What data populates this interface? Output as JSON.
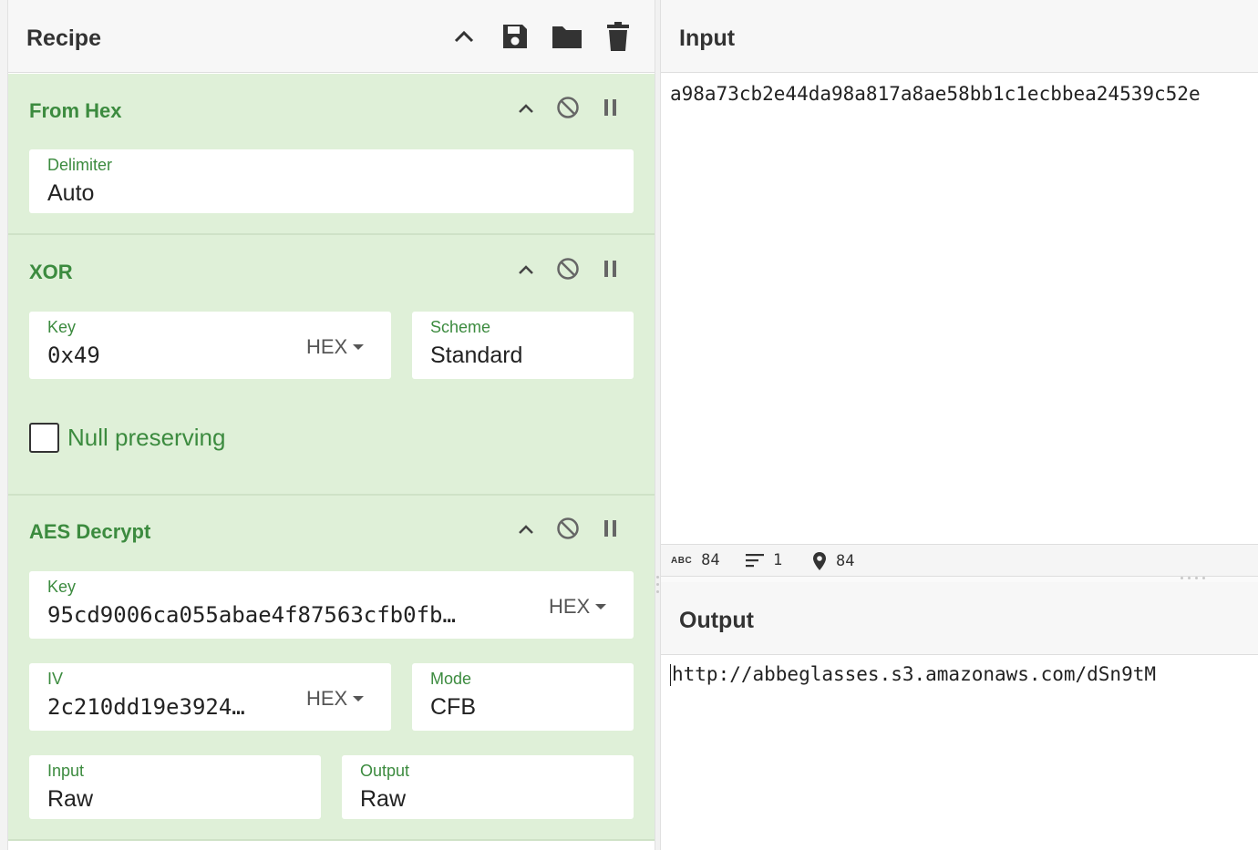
{
  "recipe": {
    "title": "Recipe",
    "operations": [
      {
        "name": "From Hex",
        "fields": [
          {
            "label": "Delimiter",
            "value": "Auto"
          }
        ]
      },
      {
        "name": "XOR",
        "fields": [
          {
            "label": "Key",
            "value": "0x49",
            "type": "HEX"
          },
          {
            "label": "Scheme",
            "value": "Standard"
          }
        ],
        "checkbox": {
          "label": "Null preserving",
          "checked": false
        }
      },
      {
        "name": "AES Decrypt",
        "fields": [
          {
            "label": "Key",
            "value": "95cd9006ca055abae4f87563cfb0fb…",
            "type": "HEX"
          },
          {
            "label": "IV",
            "value": "2c210dd19e3924…",
            "type": "HEX"
          },
          {
            "label": "Mode",
            "value": "CFB"
          },
          {
            "label": "Input",
            "value": "Raw"
          },
          {
            "label": "Output",
            "value": "Raw"
          }
        ]
      }
    ]
  },
  "input": {
    "title": "Input",
    "text": "a98a73cb2e44da98a817a8ae58bb1c1ecbbea24539c52e",
    "status": {
      "abc_label": "ABC",
      "length": "84",
      "lines": "1",
      "position": "84"
    }
  },
  "output": {
    "title": "Output",
    "text": "http://abbeglasses.s3.amazonaws.com/dSn9tM"
  },
  "colors": {
    "op_background": "#dff0d8",
    "op_accent": "#3c8b3f"
  }
}
